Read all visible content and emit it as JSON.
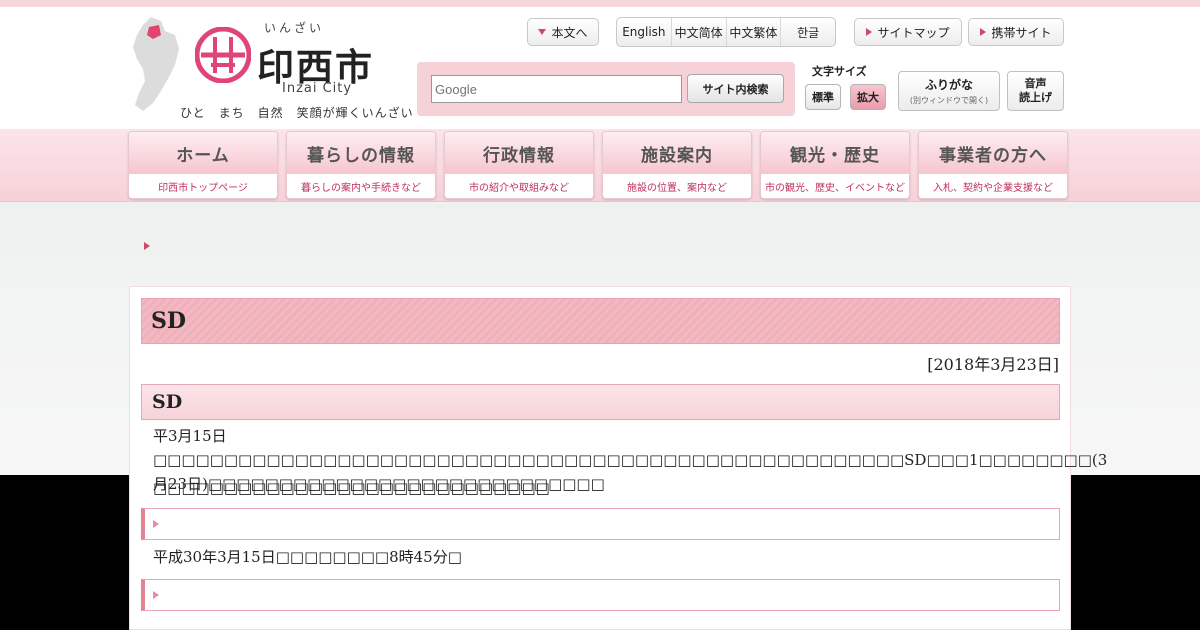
{
  "logo": {
    "ruby": "いんざい",
    "name": "印西市",
    "english": "Inzai City",
    "slogan": "ひと　まち　自然　笑顔が輝くいんざい"
  },
  "topbar": {
    "main_content": "本文へ",
    "languages": [
      "English",
      "中文简体",
      "中文繁体",
      "한글"
    ],
    "sitemap": "サイトマップ",
    "mobile": "携帯サイト"
  },
  "search": {
    "placeholder": "Google",
    "button": "サイト内検索"
  },
  "text_size": {
    "label": "文字サイズ",
    "standard": "標準",
    "large": "拡大"
  },
  "furigana": {
    "label": "ふりがな",
    "note": "(別ウィンドウで開く)"
  },
  "voice": {
    "line1": "音声",
    "line2": "読上げ"
  },
  "nav": [
    {
      "label": "ホーム",
      "sub": "印西市トップページ"
    },
    {
      "label": "暮らしの情報",
      "sub": "暮らしの案内や手続きなど"
    },
    {
      "label": "行政情報",
      "sub": "市の紹介や取組みなど"
    },
    {
      "label": "施設案内",
      "sub": "施設の位置、案内など"
    },
    {
      "label": "観光・歴史",
      "sub": "市の観光、歴史、イベントなど"
    },
    {
      "label": "事業者の方へ",
      "sub": "入札、契約や企業支援など"
    }
  ],
  "page": {
    "title": "SD",
    "date": "[2018年3月23日]",
    "section_title": "SD",
    "para1": "平3月15日□□□□□□□□□□□□□□□□□□□□□□□□□□□□□□□□□□□□□□□□□□□□□□□□□□□□□SD□□□1□□□□□□□□(3月23日)□□□□□□□□□□□□□□□□□□□□□□□□□□□□",
    "para2": "□□□□□□□□□□□□□□□□□□□□□□□□□□□□",
    "para3": "平成30年3月15日□□□□□□□□8時45分□"
  },
  "colors": {
    "accent": "#d04a6a",
    "nav_bg": "#f6d1d8",
    "title_bg": "#f2b9c2"
  }
}
